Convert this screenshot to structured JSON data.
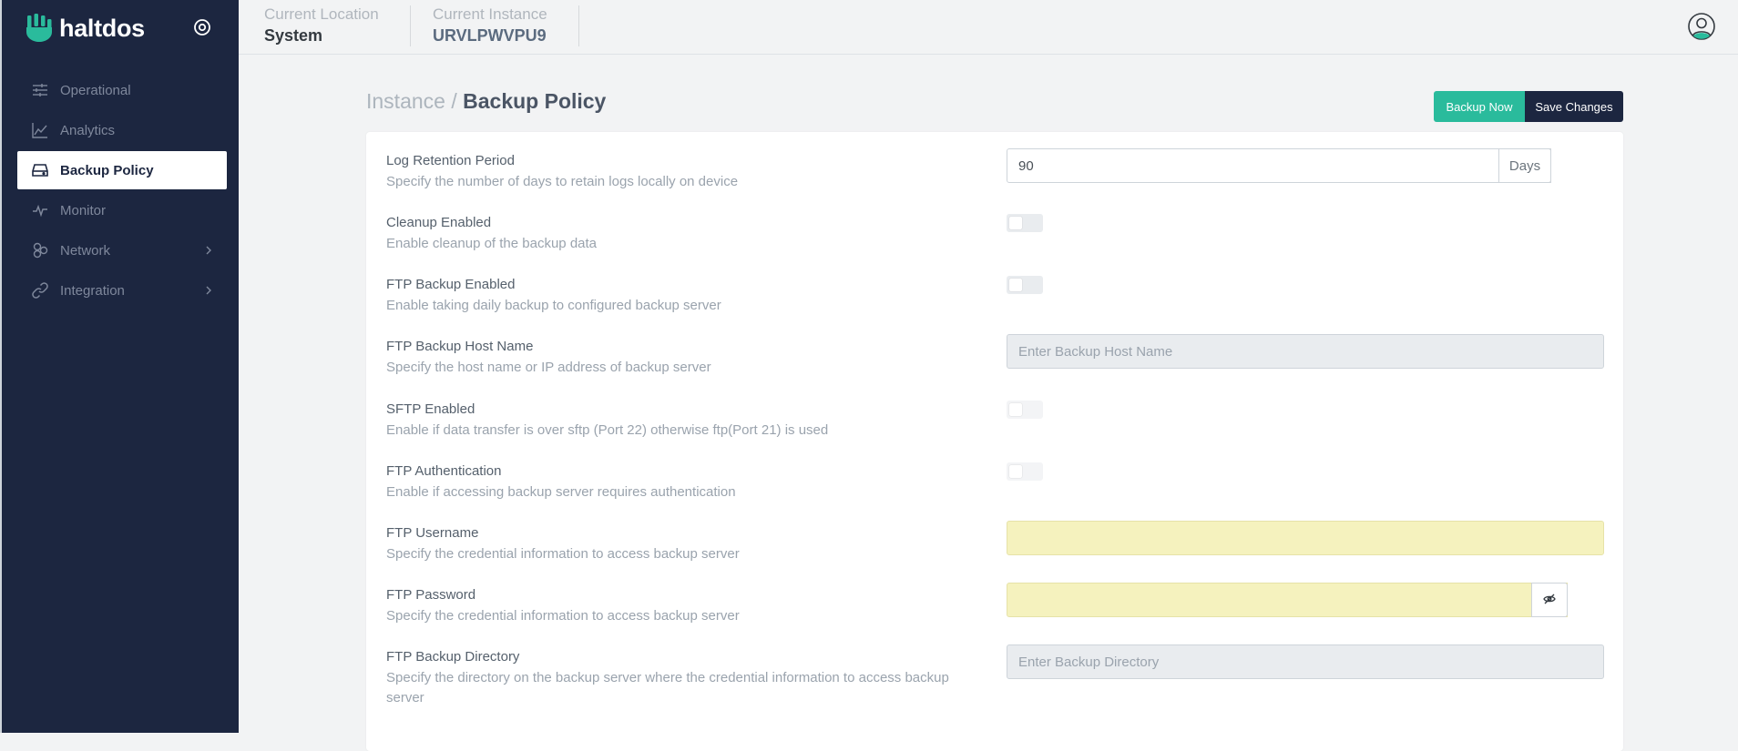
{
  "app": {
    "brand": "haltdos",
    "brand_color": "#2abb9c",
    "sidebar_bg": "#1c2640"
  },
  "sidebar": {
    "items": [
      {
        "label": "Operational",
        "icon": "sliders-icon"
      },
      {
        "label": "Analytics",
        "icon": "line-chart-icon"
      },
      {
        "label": "Backup Policy",
        "icon": "hard-drive-icon",
        "active": true
      },
      {
        "label": "Monitor",
        "icon": "pulse-icon"
      },
      {
        "label": "Network",
        "icon": "network-icon",
        "has_submenu": true
      },
      {
        "label": "Integration",
        "icon": "link-icon",
        "has_submenu": true
      }
    ]
  },
  "topbar": {
    "location_label": "Current Location",
    "location_value": "System",
    "instance_label": "Current Instance",
    "instance_value": "URVLPWVPU9"
  },
  "page": {
    "breadcrumb": "Instance /",
    "title": "Backup Policy",
    "backup_now_label": "Backup Now",
    "save_label": "Save Changes"
  },
  "settings": {
    "log_retention": {
      "title": "Log Retention Period",
      "desc": "Specify the number of days to retain logs locally on device",
      "value": "90",
      "unit": "Days"
    },
    "cleanup": {
      "title": "Cleanup Enabled",
      "desc": "Enable cleanup of the backup data",
      "enabled": false
    },
    "ftp_backup": {
      "title": "FTP Backup Enabled",
      "desc": "Enable taking daily backup to configured backup server",
      "enabled": false
    },
    "ftp_host": {
      "title": "FTP Backup Host Name",
      "desc": "Specify the host name or IP address of backup server",
      "placeholder": "Enter Backup Host Name"
    },
    "sftp": {
      "title": "SFTP Enabled",
      "desc": "Enable if data transfer is over sftp (Port 22) otherwise ftp(Port 21) is used",
      "enabled": false
    },
    "ftp_auth": {
      "title": "FTP Authentication",
      "desc": "Enable if accessing backup server requires authentication",
      "enabled": false
    },
    "ftp_username": {
      "title": "FTP Username",
      "desc": "Specify the credential information to access backup server",
      "value": ""
    },
    "ftp_password": {
      "title": "FTP Password",
      "desc": "Specify the credential information to access backup server",
      "value": "",
      "toggle_icon": "eye-off-icon"
    },
    "ftp_directory": {
      "title": "FTP Backup Directory",
      "desc": "Specify the directory on the backup server where the credential information to access backup server",
      "placeholder": "Enter Backup Directory"
    }
  }
}
